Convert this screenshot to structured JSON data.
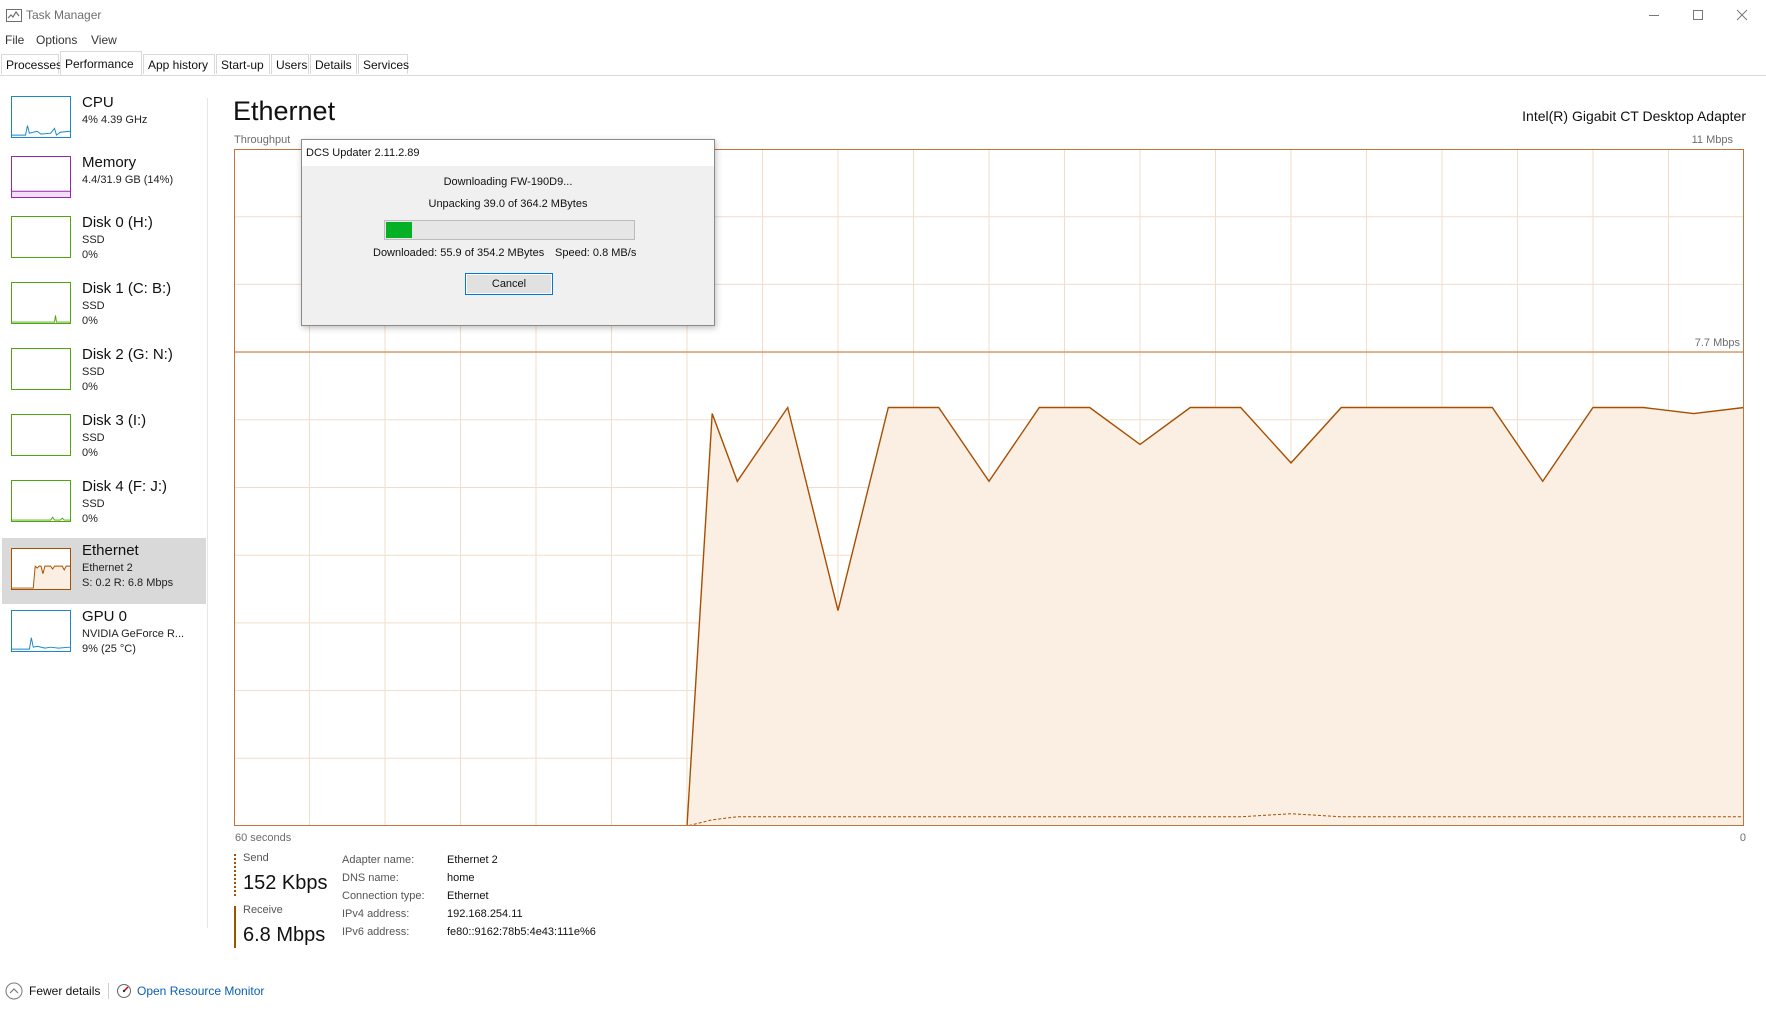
{
  "window": {
    "title": "Task Manager",
    "menu": [
      "File",
      "Options",
      "View"
    ],
    "tabs": [
      "Processes",
      "Performance",
      "App history",
      "Start-up",
      "Users",
      "Details",
      "Services"
    ],
    "active_tab": "Performance"
  },
  "sidebar": {
    "items": [
      {
        "title": "CPU",
        "line2": "4% 4.39 GHz",
        "line3": "",
        "color": "#1a87c9"
      },
      {
        "title": "Memory",
        "line2": "4.4/31.9 GB (14%)",
        "line3": "",
        "color": "#9c24b5"
      },
      {
        "title": "Disk 0 (H:)",
        "line2": "SSD",
        "line3": "0%",
        "color": "#4da60c"
      },
      {
        "title": "Disk 1 (C: B:)",
        "line2": "SSD",
        "line3": "0%",
        "color": "#4da60c"
      },
      {
        "title": "Disk 2 (G: N:)",
        "line2": "SSD",
        "line3": "0%",
        "color": "#4da60c"
      },
      {
        "title": "Disk 3 (I:)",
        "line2": "SSD",
        "line3": "0%",
        "color": "#4da60c"
      },
      {
        "title": "Disk 4 (F: J:)",
        "line2": "SSD",
        "line3": "0%",
        "color": "#4da60c"
      },
      {
        "title": "Ethernet",
        "line2": "Ethernet 2",
        "line3": "S: 0.2 R: 6.8 Mbps",
        "color": "#a74f01"
      },
      {
        "title": "GPU 0",
        "line2": "NVIDIA GeForce R...",
        "line3": "9% (25 °C)",
        "color": "#1a87c9"
      }
    ]
  },
  "main": {
    "heading": "Ethernet",
    "adapter": "Intel(R) Gigabit CT Desktop Adapter",
    "throughput_label": "Throughput",
    "max_label": "11 Mbps",
    "mid_label": "7.7 Mbps",
    "time_left": "60 seconds",
    "time_right": "0",
    "accent": "#a74f01"
  },
  "chart_data": {
    "type": "area",
    "title": "",
    "xlabel": "",
    "ylabel": "Throughput",
    "xlim": [
      60,
      0
    ],
    "ylim": [
      0,
      11
    ],
    "x": [
      60,
      42,
      41,
      40,
      38,
      36,
      34,
      32,
      30,
      28,
      26,
      24,
      22,
      20,
      18,
      16,
      14,
      12,
      10,
      8,
      6,
      4,
      2,
      0
    ],
    "series": [
      {
        "name": "Receive",
        "values": [
          0,
          0,
          6.7,
          5.6,
          6.8,
          3.5,
          6.8,
          6.8,
          5.6,
          6.8,
          6.8,
          6.2,
          6.8,
          6.8,
          5.9,
          6.8,
          6.8,
          6.8,
          6.8,
          5.6,
          6.8,
          6.8,
          6.7,
          6.8
        ]
      },
      {
        "name": "Send",
        "values": [
          0,
          0,
          0.1,
          0.15,
          0.15,
          0.15,
          0.15,
          0.15,
          0.15,
          0.15,
          0.15,
          0.15,
          0.15,
          0.15,
          0.2,
          0.15,
          0.15,
          0.15,
          0.15,
          0.15,
          0.15,
          0.15,
          0.15,
          0.15
        ]
      }
    ],
    "grid": true
  },
  "stats": {
    "send_label": "Send",
    "send_value": "152 Kbps",
    "receive_label": "Receive",
    "receive_value": "6.8 Mbps",
    "info": [
      {
        "key": "Adapter name:",
        "value": "Ethernet 2"
      },
      {
        "key": "DNS name:",
        "value": "home"
      },
      {
        "key": "Connection type:",
        "value": "Ethernet"
      },
      {
        "key": "IPv4 address:",
        "value": "192.168.254.11"
      },
      {
        "key": "IPv6 address:",
        "value": "fe80::9162:78b5:4e43:111e%6"
      }
    ]
  },
  "footer": {
    "fewer_details": "Fewer details",
    "resource_monitor": "Open Resource Monitor"
  },
  "dialog": {
    "title": "DCS Updater 2.11.2.89",
    "downloading": "Downloading FW-190D9...",
    "unpacking": "Unpacking 39.0 of 364.2 MBytes",
    "progress_fraction": 0.107,
    "downloaded": "Downloaded: 55.9 of 354.2 MBytes",
    "speed": "Speed: 0.8 MB/s",
    "cancel": "Cancel"
  }
}
